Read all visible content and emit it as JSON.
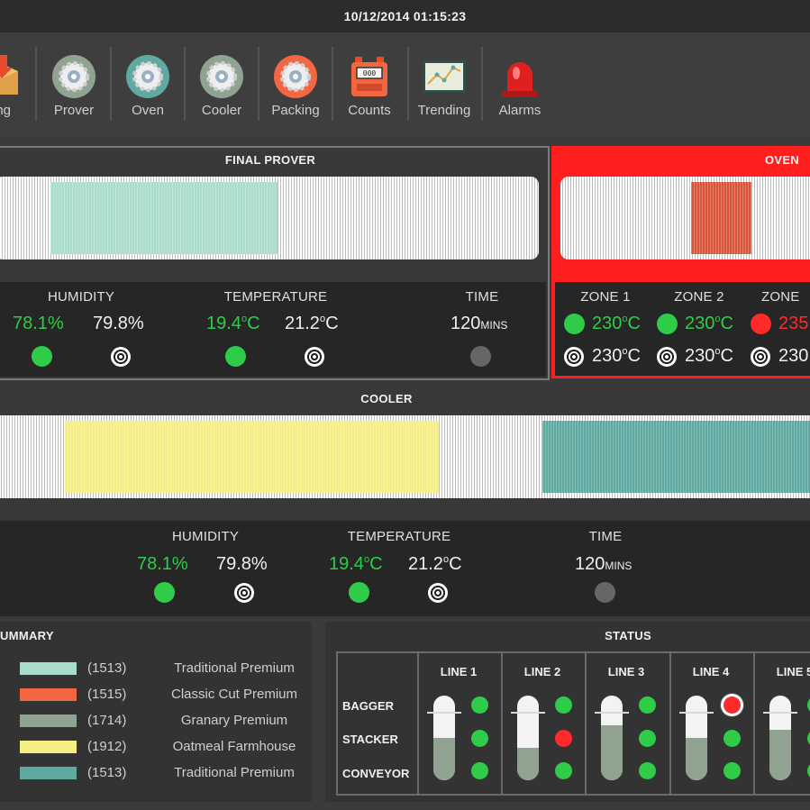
{
  "header": {
    "datetime": "10/12/2014  01:15:23"
  },
  "nav": [
    {
      "label": "ing",
      "icon": "ingredients-box-icon"
    },
    {
      "label": "Prover",
      "icon": "prover-gear-icon"
    },
    {
      "label": "Oven",
      "icon": "oven-gear-icon"
    },
    {
      "label": "Cooler",
      "icon": "cooler-gear-icon"
    },
    {
      "label": "Packing",
      "icon": "packing-gear-icon"
    },
    {
      "label": "Counts",
      "icon": "counter-icon"
    },
    {
      "label": "Trending",
      "icon": "trend-chart-icon"
    },
    {
      "label": "Alarms",
      "icon": "alarm-beacon-icon"
    }
  ],
  "final_prover": {
    "title": "FINAL PROVER",
    "fill_fraction": [
      0.09,
      0.52
    ],
    "humidity_label": "HUMIDITY",
    "humidity_actual": "78.1%",
    "humidity_set": "79.8%",
    "temperature_label": "TEMPERATURE",
    "temperature_actual": "19.4",
    "temperature_set": "21.2",
    "temp_unit": "C",
    "deg": "o",
    "time_label": "TIME",
    "time_value": "120",
    "time_unit": "MINS"
  },
  "oven": {
    "title": "OVEN",
    "zones": [
      {
        "label": "ZONE 1",
        "actual": "230",
        "set": "230",
        "status": "ok"
      },
      {
        "label": "ZONE 2",
        "actual": "230",
        "set": "230",
        "status": "ok"
      },
      {
        "label": "ZONE",
        "actual": "235",
        "set": "230",
        "status": "alarm"
      }
    ],
    "temp_unit": "C",
    "deg": "o"
  },
  "cooler": {
    "title": "COOLER",
    "humidity_label": "HUMIDITY",
    "humidity_actual": "78.1%",
    "humidity_set": "79.8%",
    "temperature_label": "TEMPERATURE",
    "temperature_actual": "19.4",
    "temperature_set": "21.2",
    "temp_unit": "C",
    "deg": "o",
    "time_label": "TIME",
    "time_value": "120",
    "time_unit": "MINS"
  },
  "summary": {
    "title": "UMMARY",
    "items": [
      {
        "code": "(1513)",
        "name": "Traditional Premium",
        "color": "#a9dccb"
      },
      {
        "code": "(1515)",
        "name": "Classic Cut Premium",
        "color": "#f26642"
      },
      {
        "code": "(1714)",
        "name": "Granary Premium",
        "color": "#8fa390"
      },
      {
        "code": "(1912)",
        "name": "Oatmeal Farmhouse",
        "color": "#f4ee84"
      },
      {
        "code": "(1513)",
        "name": "Traditional Premium",
        "color": "#5fa9a0"
      }
    ]
  },
  "status": {
    "title": "STATUS",
    "rows": [
      "BAGGER",
      "STACKER",
      "CONVEYOR"
    ],
    "lines": [
      {
        "label": "LINE 1",
        "level": 0.5,
        "states": [
          "ok",
          "ok",
          "ok"
        ]
      },
      {
        "label": "LINE 2",
        "level": 0.38,
        "states": [
          "ok",
          "alarm",
          "ok"
        ]
      },
      {
        "label": "LINE 3",
        "level": 0.65,
        "states": [
          "ok",
          "ok",
          "ok"
        ]
      },
      {
        "label": "LINE 4",
        "level": 0.5,
        "states": [
          "alarm",
          "ok",
          "ok"
        ]
      },
      {
        "label": "LINE 5",
        "level": 0.6,
        "states": [
          "ok",
          "ok",
          "ok"
        ]
      }
    ]
  },
  "colors": {
    "ok": "#2fcc4a",
    "alarm": "#ff2a2a",
    "idle": "#666666",
    "oven_panel": "#ff1f1f"
  }
}
